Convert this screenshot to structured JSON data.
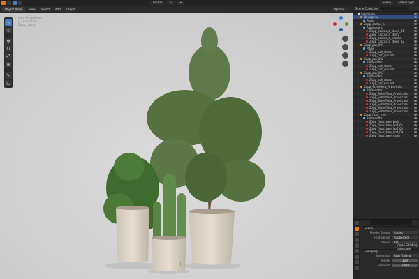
{
  "topbar": {
    "center": [
      "Global",
      "⊙",
      "✦"
    ],
    "scene": "Scene",
    "view_layer": "View Layer"
  },
  "header": {
    "mode": "Object Mode",
    "menus": [
      "View",
      "Select",
      "Add",
      "Object"
    ],
    "options": "Options"
  },
  "viewport": {
    "overlay": [
      "User Perspective",
      "(1) Collection",
      "Zapp_cactus"
    ],
    "tools": [
      "cursor",
      "move",
      "rotate",
      "scale",
      "transform",
      "annotate",
      "measure"
    ]
  },
  "outliner": {
    "title": "Scene Collection",
    "rows": [
      {
        "label": "Collection",
        "icon": "coll",
        "indent": 1,
        "sel": false
      },
      {
        "label": "Navigation",
        "icon": "obj",
        "indent": 2,
        "sel": true
      },
      {
        "label": "Plane",
        "icon": "mod",
        "indent": 3,
        "sel": false
      },
      {
        "label": "Zapp_cactus_a",
        "icon": "obj",
        "indent": 2,
        "sel": false
      },
      {
        "label": "Rebreadths",
        "icon": "mod",
        "indent": 3,
        "sel": false
      },
      {
        "label": "Zapp_cactus_a_stone_01",
        "icon": "mat",
        "indent": 4,
        "sel": false
      },
      {
        "label": "Zapp_cactus_a_stem",
        "icon": "mat",
        "indent": 4,
        "sel": false
      },
      {
        "label": "Zapp_cactus_a_needle",
        "icon": "mat",
        "indent": 4,
        "sel": false
      },
      {
        "label": "Zapp_cactus_a_stone_02",
        "icon": "mat",
        "indent": 4,
        "sel": false
      },
      {
        "label": "Zapp_pot_001",
        "icon": "obj",
        "indent": 2,
        "sel": false
      },
      {
        "label": "Plane",
        "icon": "mod",
        "indent": 3,
        "sel": false
      },
      {
        "label": "Zapp_pot_stone",
        "icon": "mat",
        "indent": 4,
        "sel": false
      },
      {
        "label": "Zapp_pot_ground",
        "icon": "mat",
        "indent": 4,
        "sel": false
      },
      {
        "label": "Zapp_pot_002",
        "icon": "obj",
        "indent": 2,
        "sel": false
      },
      {
        "label": "Rebreadths",
        "icon": "mod",
        "indent": 3,
        "sel": false
      },
      {
        "label": "Zapp_pot_stone",
        "icon": "mat",
        "indent": 4,
        "sel": false
      },
      {
        "label": "Zapp_pot_ground",
        "icon": "mat",
        "indent": 4,
        "sel": false
      },
      {
        "label": "Zapp_pot_003",
        "icon": "obj",
        "indent": 2,
        "sel": false
      },
      {
        "label": "Rebreadths",
        "icon": "mod",
        "indent": 3,
        "sel": false
      },
      {
        "label": "Zapp_pot_stone",
        "icon": "mat",
        "indent": 4,
        "sel": false
      },
      {
        "label": "Zapp_pot_ground",
        "icon": "mat",
        "indent": 4,
        "sel": false
      },
      {
        "label": "Zapp_Schefflera_Arboricola",
        "icon": "obj",
        "indent": 2,
        "sel": false
      },
      {
        "label": "Rebreadths",
        "icon": "mod",
        "indent": 3,
        "sel": false
      },
      {
        "label": "Zapp_Schefflera_Arboricola",
        "icon": "mat",
        "indent": 4,
        "sel": false
      },
      {
        "label": "Zapp_Schefflera_Arboricola",
        "icon": "mat",
        "indent": 4,
        "sel": false
      },
      {
        "label": "Zapp_Schefflera_Arboricola",
        "icon": "mat",
        "indent": 4,
        "sel": false
      },
      {
        "label": "Zapp_Schefflera_Arboricola",
        "icon": "mat",
        "indent": 4,
        "sel": false
      },
      {
        "label": "Zapp_Schefflera_Arboricola",
        "icon": "mat",
        "indent": 4,
        "sel": false
      },
      {
        "label": "Zapp_Schefflera_Arboricola",
        "icon": "mat",
        "indent": 4,
        "sel": false
      },
      {
        "label": "Zapp_ficus_tree",
        "icon": "obj",
        "indent": 2,
        "sel": false
      },
      {
        "label": "Rebreadths",
        "icon": "mod",
        "indent": 3,
        "sel": false
      },
      {
        "label": "Zapp_ficus_tree_bark",
        "icon": "mat",
        "indent": 4,
        "sel": false
      },
      {
        "label": "Zapp_ficus_tree_leaf_01",
        "icon": "mat",
        "indent": 4,
        "sel": false
      },
      {
        "label": "Zapp_ficus_tree_leaf_02",
        "icon": "mat",
        "indent": 4,
        "sel": false
      },
      {
        "label": "Zapp_ficus_tree_leaf_03",
        "icon": "mat",
        "indent": 4,
        "sel": false
      },
      {
        "label": "Zapp_ficus_tree_stem",
        "icon": "mat",
        "indent": 4,
        "sel": false
      }
    ]
  },
  "properties": {
    "scene_label": "Scene",
    "render_engine_label": "Render Engine",
    "render_engine": "Cycles",
    "feature_set_label": "Feature Set",
    "feature_set": "Supported",
    "device_label": "Device",
    "device": "CPU",
    "osl_label": "Open Shading Language",
    "sampling_label": "Sampling",
    "integrator_label": "Integrator",
    "integrator": "Path Tracing",
    "render_label": "Render",
    "render_samples": "128",
    "viewport_label": "Viewport",
    "viewport_samples": "1000"
  },
  "colors": {
    "accent": "#e07a1b",
    "selection": "#334d80",
    "viewport_bg": "#d3d3d3"
  }
}
